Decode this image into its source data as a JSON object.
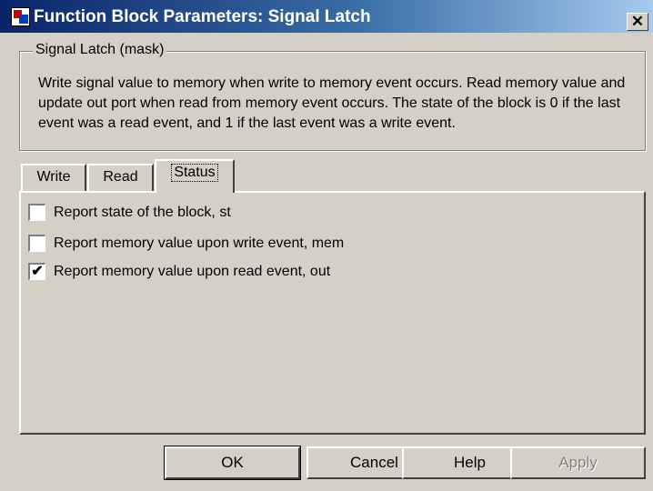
{
  "window": {
    "title": "Function Block Parameters: Signal Latch",
    "close_label": "✕"
  },
  "group": {
    "legend": "Signal Latch (mask)",
    "description": "Write signal value to memory when write to memory event occurs. Read memory value and update out port when read from memory event occurs. The state of the block is 0 if the last event was a read event, and 1 if the last event was a write event."
  },
  "tabs": [
    {
      "label": "Write",
      "active": false
    },
    {
      "label": "Read",
      "active": false
    },
    {
      "label": "Status",
      "active": true
    }
  ],
  "status_options": [
    {
      "label": "Report state of the block, st",
      "checked": false
    },
    {
      "label": "Report memory value upon write event, mem",
      "checked": false
    },
    {
      "label": "Report memory value upon read event, out",
      "checked": true
    }
  ],
  "buttons": {
    "ok": "OK",
    "cancel": "Cancel",
    "help": "Help",
    "apply": "Apply"
  },
  "check_mark": "✔"
}
